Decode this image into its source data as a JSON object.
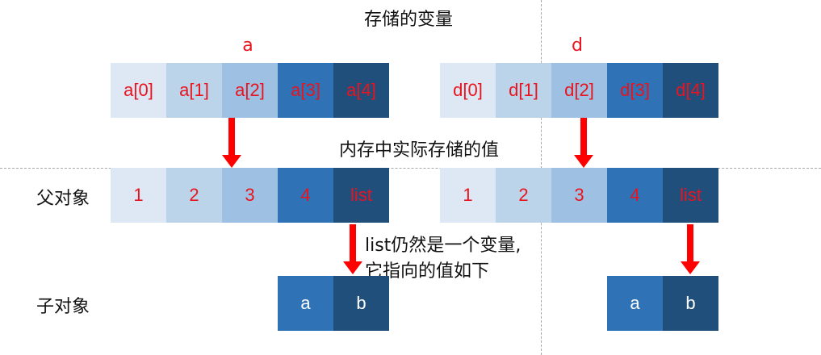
{
  "title": "存储的变量",
  "stored_label": "内存中实际存储的值",
  "parent_label": "父对象",
  "child_label": "子对象",
  "note_line1": "list仍然是一个变量,",
  "note_line2": "它指向的值如下",
  "left": {
    "var_name": "a",
    "vars": [
      "a[0]",
      "a[1]",
      "a[2]",
      "a[3]",
      "a[4]"
    ],
    "values": [
      "1",
      "2",
      "3",
      "4",
      "list"
    ],
    "child": [
      "a",
      "b"
    ]
  },
  "right": {
    "var_name": "d",
    "vars": [
      "d[0]",
      "d[1]",
      "d[2]",
      "d[3]",
      "d[4]"
    ],
    "values": [
      "1",
      "2",
      "3",
      "4",
      "list"
    ],
    "child": [
      "a",
      "b"
    ]
  },
  "colors": {
    "text_red": "#e8141e",
    "arrow_red": "#ff0000",
    "shades": [
      "#dde8f4",
      "#bcd4ea",
      "#9ec0e2",
      "#2f72b6",
      "#214f7b"
    ]
  }
}
